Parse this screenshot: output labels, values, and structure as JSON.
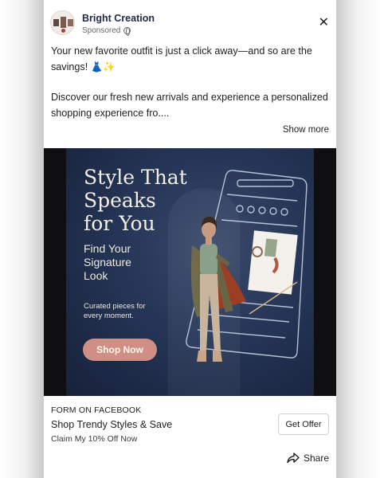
{
  "post": {
    "page_name": "Bright Creation",
    "sponsored_label": "Sponsored",
    "close_glyph": "✕",
    "text_line1": "Your new favorite outfit is just a click away—and so are the savings! 👗✨",
    "text_line2": "Discover our fresh new arrivals and experience a personalized shopping experience fro....",
    "show_more": "Show more"
  },
  "creative": {
    "headline": [
      "Style That",
      "Speaks",
      "for You"
    ],
    "subhead": [
      "Find Your",
      "Signature",
      "Look"
    ],
    "curated": [
      "Curated pieces for",
      "every moment."
    ],
    "button_label": "Shop Now"
  },
  "cta": {
    "type": "FORM ON FACEBOOK",
    "title": "Shop Trendy Styles & Save",
    "description": "Claim My 10% Off Now",
    "button_label": "Get Offer",
    "share_label": "Share"
  },
  "colors": {
    "creative_bg": "#243556",
    "shop_button": "#d08f84",
    "page_name": "#1f2a44"
  },
  "icons": [
    "globe-icon",
    "close-icon",
    "share-icon"
  ]
}
